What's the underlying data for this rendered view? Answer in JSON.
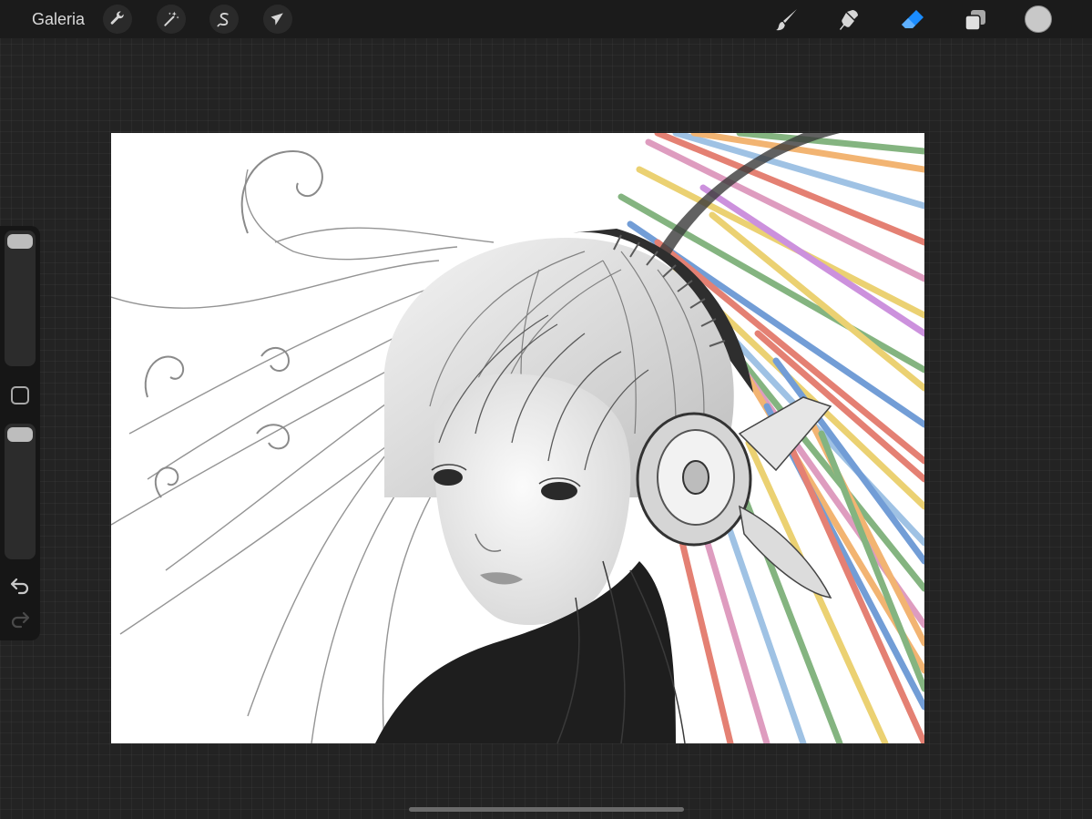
{
  "topbar": {
    "gallery_label": "Galeria",
    "left_tools": [
      "wrench-icon",
      "magic-wand-icon",
      "selection-s-icon",
      "transform-arrow-icon"
    ],
    "right_tools": [
      "brush-icon",
      "smudge-icon",
      "eraser-icon",
      "layers-icon"
    ],
    "active_tool": "eraser-icon",
    "active_tool_color": "#1a8cff",
    "current_color": "#c8c8c8"
  },
  "sidebar": {
    "brush_size_slider": 1.0,
    "opacity_slider": 1.0,
    "icons": [
      "modify-square-icon",
      "undo-icon",
      "redo-icon"
    ]
  },
  "canvas": {
    "background": "#ffffff"
  }
}
